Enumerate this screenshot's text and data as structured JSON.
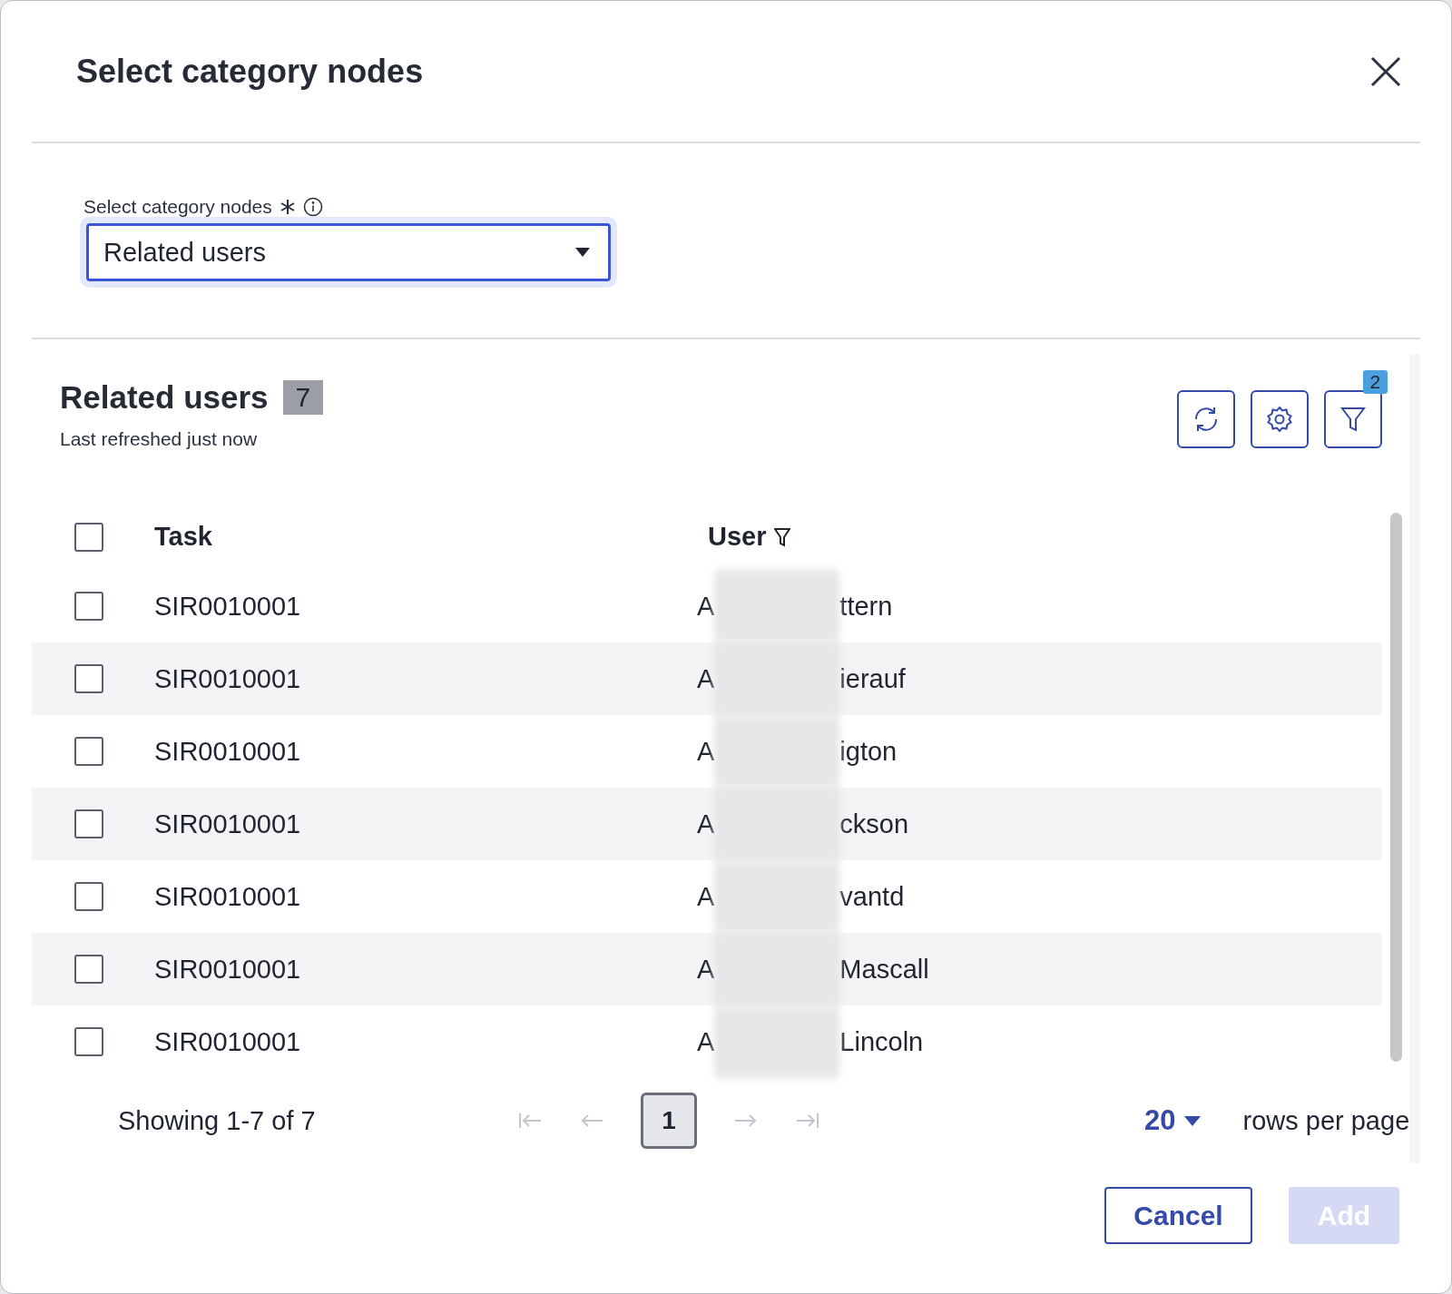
{
  "dialog": {
    "title": "Select category nodes"
  },
  "category_field": {
    "label": "Select category nodes",
    "required": true,
    "value": "Related users"
  },
  "section": {
    "title": "Related users",
    "count": "7",
    "subtitle": "Last refreshed just now",
    "filter_count": "2"
  },
  "table": {
    "header_checked": false,
    "columns": [
      {
        "label": "Task",
        "filter": false
      },
      {
        "label": "User",
        "filter": true
      }
    ],
    "rows": [
      {
        "checked": false,
        "task": "SIR0010001",
        "user_start": "A",
        "user_end": "ttern"
      },
      {
        "checked": false,
        "task": "SIR0010001",
        "user_start": "A",
        "user_end": "ierauf"
      },
      {
        "checked": false,
        "task": "SIR0010001",
        "user_start": "A",
        "user_end": "igton"
      },
      {
        "checked": false,
        "task": "SIR0010001",
        "user_start": "A",
        "user_end": "ckson"
      },
      {
        "checked": false,
        "task": "SIR0010001",
        "user_start": "A",
        "user_end": "vantd"
      },
      {
        "checked": false,
        "task": "SIR0010001",
        "user_start": "A",
        "user_end": "Mascall"
      },
      {
        "checked": false,
        "task": "SIR0010001",
        "user_start": "A",
        "user_end": "Lincoln"
      }
    ]
  },
  "pagination": {
    "summary": "Showing 1-7 of 7",
    "pages": [
      {
        "label": "1",
        "selected": true
      }
    ],
    "rows_per_page": "20",
    "rows_per_page_label": "rows per page"
  },
  "buttons": [
    {
      "label": "Cancel",
      "kind": "secondary",
      "disabled": false
    },
    {
      "label": "Add",
      "kind": "primary",
      "disabled": true
    }
  ]
}
